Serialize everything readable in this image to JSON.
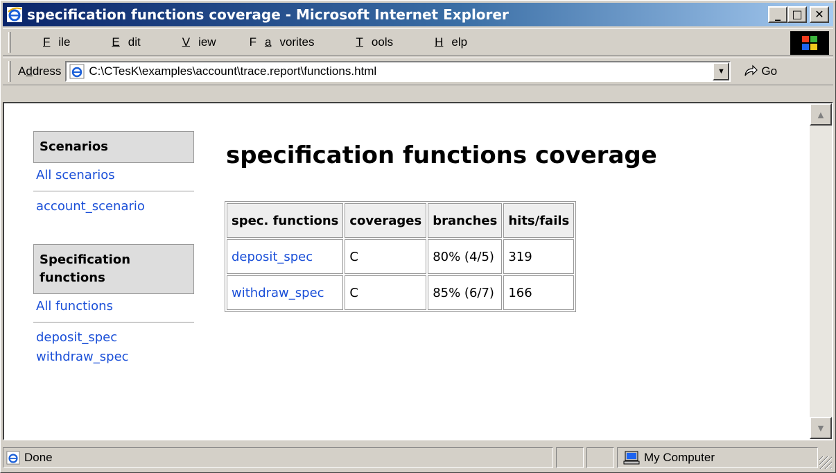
{
  "window": {
    "title": "specification functions coverage - Microsoft Internet Explorer",
    "min_label": "_",
    "max_label": "□",
    "close_label": "✕"
  },
  "menu": [
    {
      "pre": "",
      "u": "F",
      "post": "ile"
    },
    {
      "pre": "",
      "u": "E",
      "post": "dit"
    },
    {
      "pre": "",
      "u": "V",
      "post": "iew"
    },
    {
      "pre": "F",
      "u": "a",
      "post": "vorites"
    },
    {
      "pre": "",
      "u": "T",
      "post": "ools"
    },
    {
      "pre": "",
      "u": "H",
      "post": "elp"
    }
  ],
  "address": {
    "label_pre": "A",
    "label_u": "d",
    "label_post": "dress",
    "value": "C:\\CTesK\\examples\\account\\trace.report\\functions.html",
    "go_label": "Go"
  },
  "page": {
    "title": "specification functions coverage",
    "nav": {
      "scenarios_heading": "Scenarios",
      "all_scenarios": "All scenarios",
      "scenario_items": [
        "account_scenario"
      ],
      "functions_heading": "Specification functions",
      "all_functions": "All functions",
      "function_items": [
        "deposit_spec",
        "withdraw_spec"
      ]
    },
    "table": {
      "headers": [
        "spec. functions",
        "coverages",
        "branches",
        "hits/fails"
      ],
      "rows": [
        [
          "deposit_spec",
          "C",
          "80% (4/5)",
          "319"
        ],
        [
          "withdraw_spec",
          "C",
          "85% (6/7)",
          "166"
        ]
      ]
    }
  },
  "status": {
    "text": "Done",
    "zone": "My Computer"
  }
}
